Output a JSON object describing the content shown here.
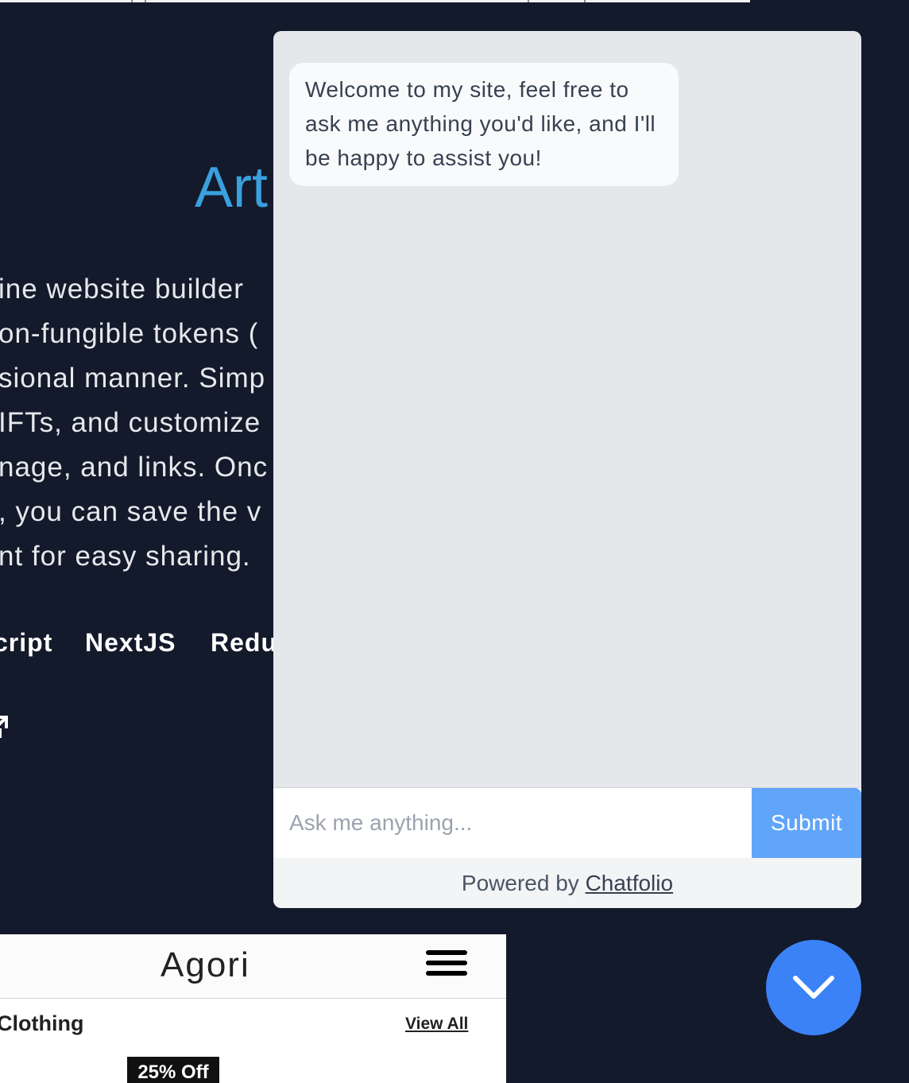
{
  "background_page": {
    "project_title": "Art",
    "description_lines": [
      "ine website builder",
      "on-fungible tokens (",
      "sional manner. Simp",
      "IFTs, and customize",
      "nage, and links. Onc",
      ", you can save the v",
      "nt for easy sharing."
    ],
    "tech_stack": [
      "cript",
      "NextJS",
      "Redu"
    ],
    "preview": {
      "logo": "Agori",
      "section_title": "Clothing",
      "view_all": "View All",
      "badge": "25% Off"
    }
  },
  "chat": {
    "welcome_message": "Welcome to my site, feel free to ask me anything you'd like, and I'll be happy to assist you!",
    "input_placeholder": "Ask me anything...",
    "submit_label": "Submit",
    "footer_prefix": "Powered by",
    "footer_link": "Chatfolio",
    "toggle_icon": "chevron-down-icon"
  },
  "colors": {
    "page_background": "#131a2b",
    "title_accent": "#3aa0de",
    "submit_button": "#60a5fa",
    "toggle_button": "#3b82f6"
  }
}
